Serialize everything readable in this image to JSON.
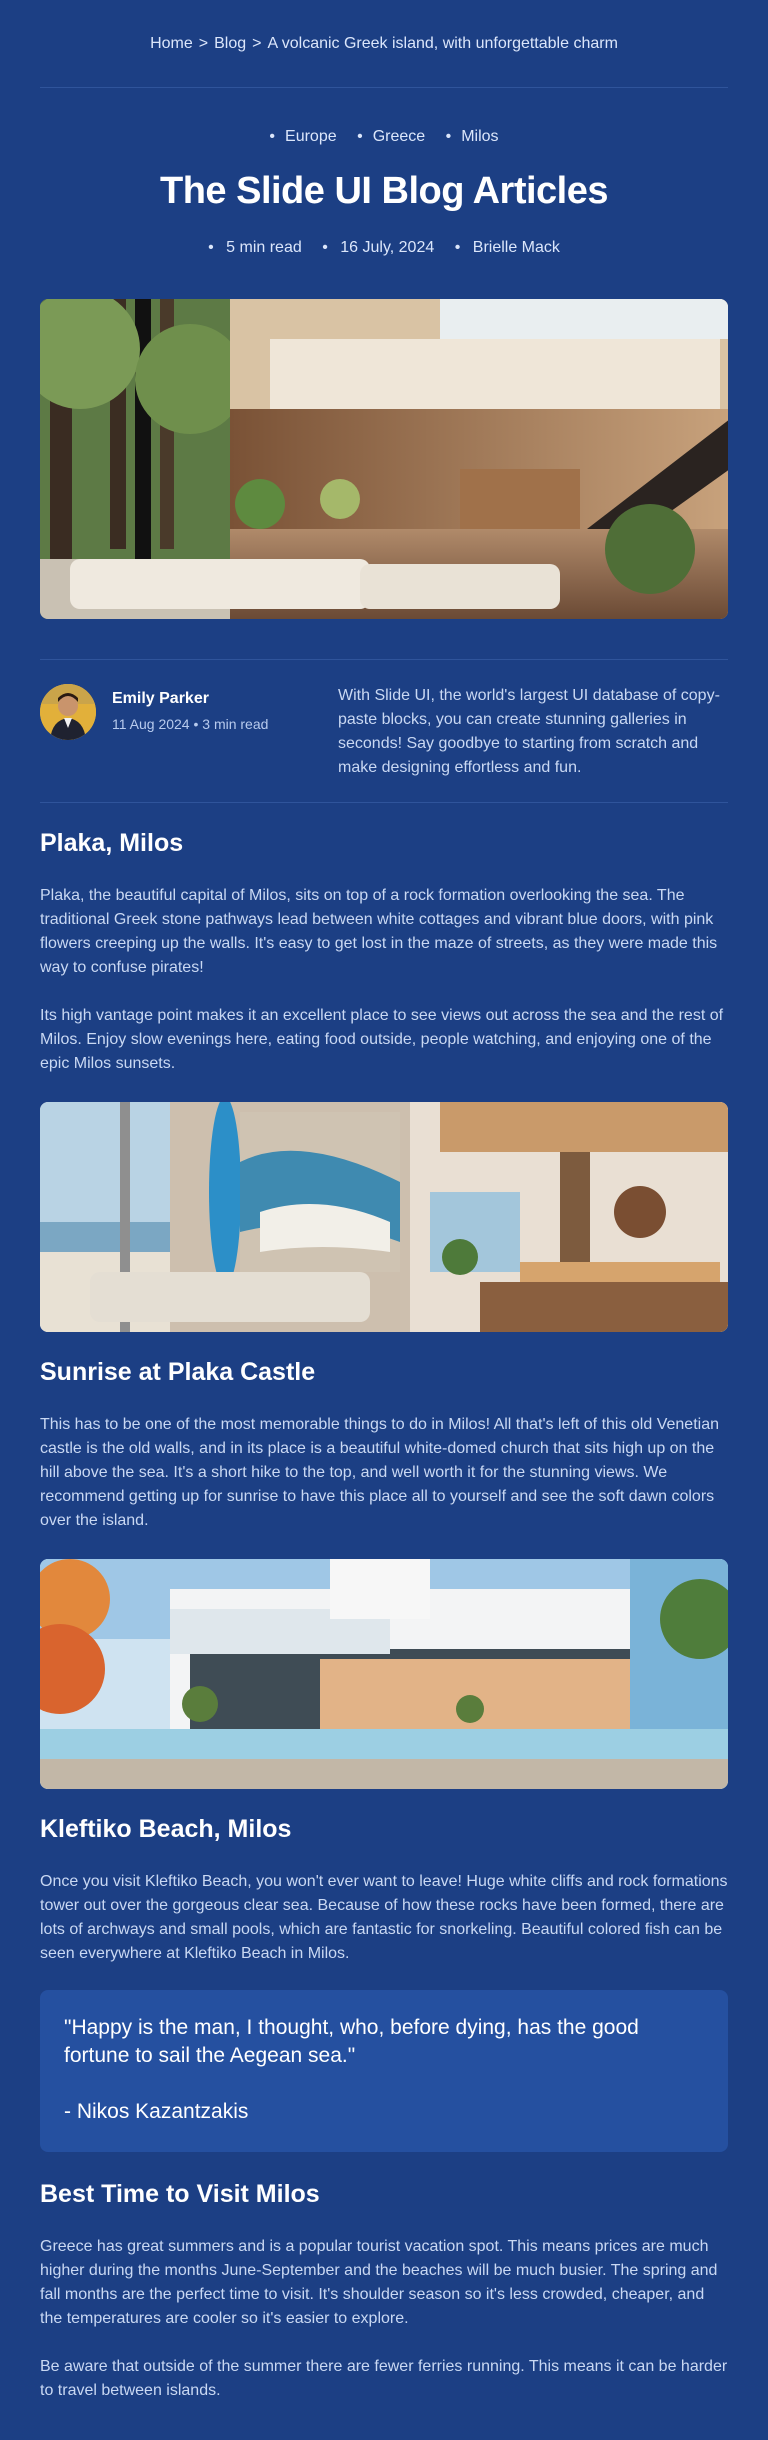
{
  "breadcrumb": {
    "items": [
      "Home",
      "Blog",
      "A volcanic Greek island, with unforgettable charm"
    ],
    "separator": ">"
  },
  "tags": [
    "Europe",
    "Greece",
    "Milos"
  ],
  "title": "The Slide UI Blog Articles",
  "meta": [
    "5 min read",
    "16 July, 2024",
    "Brielle Mack"
  ],
  "author": {
    "name": "Emily Parker",
    "meta": "11 Aug 2024 • 3 min read",
    "blurb": "With Slide UI, the world's largest UI database of copy-paste blocks, you can create stunning galleries in seconds! Say goodbye to starting from scratch and make designing effortless and fun."
  },
  "sections": {
    "plaka": {
      "title": "Plaka, Milos",
      "p1": "Plaka, the beautiful capital of Milos, sits on top of a rock formation overlooking the sea. The traditional Greek stone pathways lead between white cottages and vibrant blue doors, with pink flowers creeping up the walls. It's easy to get lost in the maze of streets, as they were made this way to confuse pirates!",
      "p2": "Its high vantage point makes it an excellent place to see views out across the sea and the rest of Milos. Enjoy slow evenings here, eating food outside, people watching, and enjoying one of the epic Milos sunsets."
    },
    "sunrise": {
      "title": "Sunrise at Plaka Castle",
      "p1": "This has to be one of the most memorable things to do in Milos! All that's left of this old Venetian castle is the old walls, and in its place is a beautiful white-domed church that sits high up on the hill above the sea. It's a short hike to the top, and well worth it for the stunning views. We recommend getting up for sunrise to have this place all to yourself and see the soft dawn colors over the island."
    },
    "kleftiko": {
      "title": "Kleftiko Beach, Milos",
      "p1": "Once you visit Kleftiko Beach, you won't ever want to leave! Huge white cliffs and rock formations tower out over the gorgeous clear sea. Because of how these rocks have been formed, there are lots of archways and small pools, which are fantastic for snorkeling. Beautiful colored fish can be seen everywhere at Kleftiko Beach in Milos."
    },
    "quote": {
      "text": "\"Happy is the man, I thought, who, before dying, has the good fortune to sail the Aegean sea.\"",
      "author": "- Nikos Kazantzakis"
    },
    "best": {
      "title": "Best Time to Visit Milos",
      "p1": "Greece has great summers and is a popular tourist vacation spot. This means prices are much higher during the months June-September and the beaches will be much busier. The spring and fall months are the perfect time to visit. It's shoulder season so it's less crowded, cheaper, and the temperatures are cooler so it's easier to explore.",
      "p2": "Be aware that outside of the summer there are fewer ferries running. This means it can be harder to travel between islands."
    }
  }
}
